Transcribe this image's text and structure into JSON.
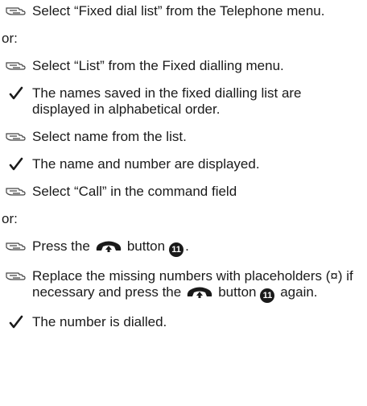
{
  "items": [
    {
      "type": "step",
      "icon": "pointing-hand-icon",
      "text": "Select “Fixed dial list” from the Telephone menu."
    },
    {
      "type": "or",
      "text": "or:"
    },
    {
      "type": "step",
      "icon": "pointing-hand-icon",
      "text": "Select “List” from the Fixed dialling menu."
    },
    {
      "type": "result",
      "icon": "checkmark-icon",
      "text": "The names saved in the fixed dialling list are displayed in alphabetical order."
    },
    {
      "type": "step",
      "icon": "pointing-hand-icon",
      "text": "Select name from the list."
    },
    {
      "type": "result",
      "icon": "checkmark-icon",
      "text": "The name and number are displayed."
    },
    {
      "type": "step",
      "icon": "pointing-hand-icon",
      "text": "Select “Call” in the command field"
    },
    {
      "type": "or",
      "text": "or:"
    },
    {
      "type": "step",
      "icon": "pointing-hand-icon",
      "text_before": "Press the",
      "inline_icon": "phone-handset-icon",
      "text_after": "button",
      "badge": "11",
      "text_end": "."
    },
    {
      "type": "step",
      "icon": "pointing-hand-icon",
      "text_before": "Replace the missing numbers with placeholders (¤) if necessary and press the",
      "inline_icon": "phone-handset-icon",
      "text_after": "button",
      "badge": "11",
      "text_end": " again."
    },
    {
      "type": "result",
      "icon": "checkmark-icon",
      "text": "The number is dialled."
    }
  ]
}
